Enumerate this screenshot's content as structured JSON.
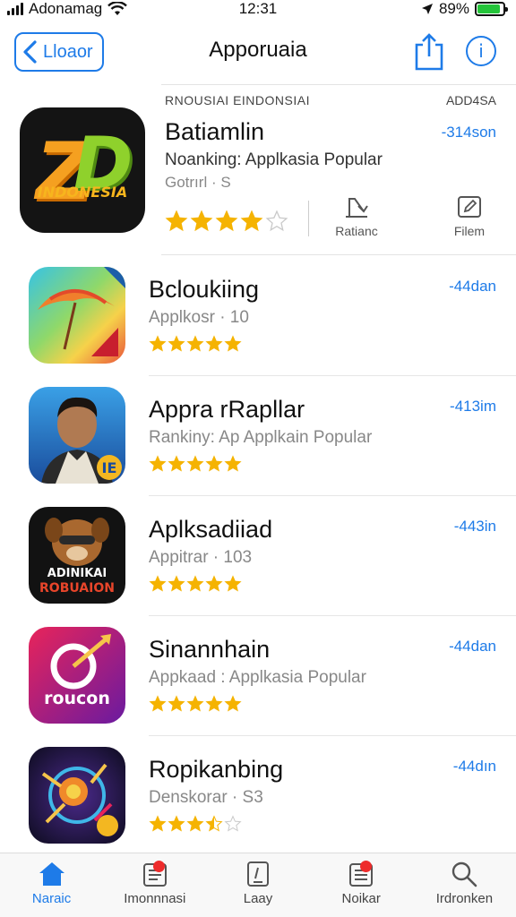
{
  "status_bar": {
    "carrier": "Adonamag",
    "time": "12:31",
    "battery_percent": "89%",
    "battery_level": 0.89
  },
  "nav": {
    "back_label": "Lloaor",
    "title": "Apporuaia"
  },
  "featured": {
    "header": "RNOUSIAI EINDONSIAI",
    "header_right": "ADD4SA",
    "icon_word": "INDONESIA",
    "name": "Batiamlin",
    "subtitle": "Noanking: Applkasia Popular",
    "meta": "Gotrırl · S",
    "price": "-314son",
    "rating": 4,
    "actions": [
      {
        "label": "Ratianc",
        "icon": "share-arrow-icon"
      },
      {
        "label": "Filem",
        "icon": "edit-icon"
      }
    ]
  },
  "apps": [
    {
      "name": "Bcloukiing",
      "subtitle": "Applkosr · 10",
      "price": "-44dan",
      "rating": 5
    },
    {
      "name": "Appra rRapllar",
      "subtitle": "Rankiny: Ap Applkain Popular",
      "price": "-413im",
      "rating": 5
    },
    {
      "name": "Aplksadiiad",
      "subtitle": "Appitrar · 103",
      "price": "-443in",
      "rating": 5,
      "icon_words": [
        "ADINIKAI",
        "ROBUAION"
      ]
    },
    {
      "name": "Sinannhain",
      "subtitle": "Appkaad : Applkasia Popular",
      "price": "-44dan",
      "rating": 5,
      "icon_words": [
        "roucon"
      ]
    },
    {
      "name": "Ropikanbing",
      "subtitle": "Denskorar · S3",
      "price": "-44dın",
      "rating": 3.5
    }
  ],
  "tabs": [
    {
      "label": "Naraic",
      "icon": "home-icon",
      "active": true,
      "badge": false
    },
    {
      "label": "Imonnnasi",
      "icon": "document-icon",
      "active": false,
      "badge": true
    },
    {
      "label": "Laay",
      "icon": "note-icon",
      "active": false,
      "badge": false
    },
    {
      "label": "Noikar",
      "icon": "list-icon",
      "active": false,
      "badge": true
    },
    {
      "label": "Irdronken",
      "icon": "search-icon",
      "active": false,
      "badge": false
    }
  ],
  "colors": {
    "accent": "#1e7be8",
    "star": "#f5b301",
    "badge": "#ee2b2b"
  }
}
